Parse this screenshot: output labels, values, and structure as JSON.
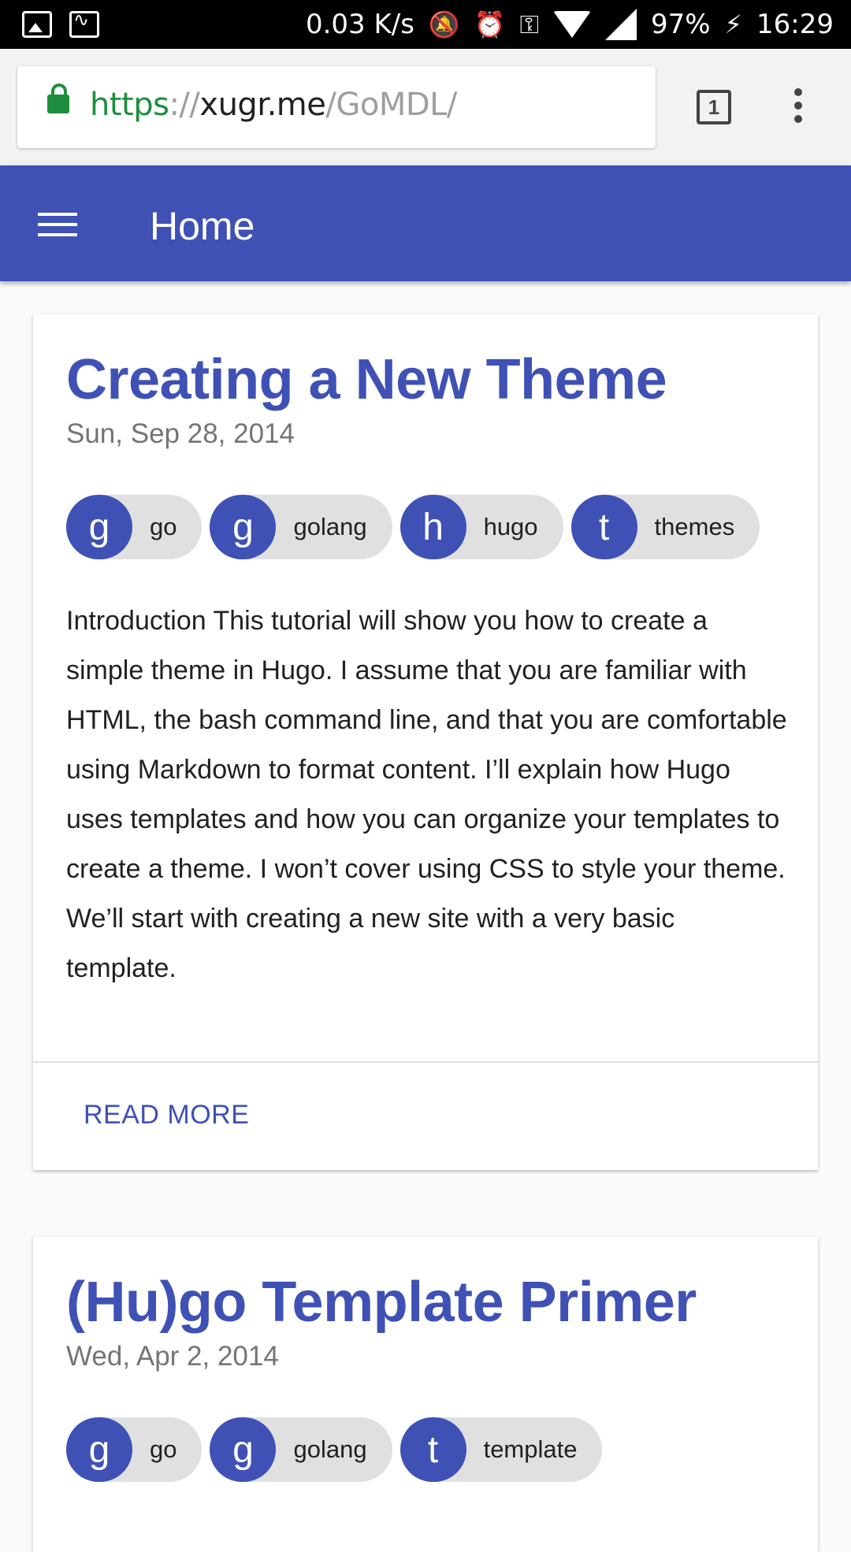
{
  "status_bar": {
    "speed": "0.03 K/s",
    "battery": "97%",
    "time": "16:29"
  },
  "browser": {
    "url_scheme": "https",
    "url_sep": "://",
    "url_host": "xugr.me",
    "url_path": "/GoMDL/",
    "tab_count": "1"
  },
  "app_bar": {
    "title": "Home"
  },
  "posts": [
    {
      "title": "Creating a New Theme",
      "date": "Sun, Sep 28, 2014",
      "tags": [
        {
          "initial": "g",
          "label": "go"
        },
        {
          "initial": "g",
          "label": "golang"
        },
        {
          "initial": "h",
          "label": "hugo"
        },
        {
          "initial": "t",
          "label": "themes"
        }
      ],
      "excerpt": "Introduction This tutorial will show you how to create a simple theme in Hugo. I assume that you are familiar with HTML, the bash command line, and that you are comfortable using Markdown to format content. I’ll explain how Hugo uses templates and how you can organize your templates to create a theme. I won’t cover using CSS to style your theme. We’ll start with creating a new site with a very basic template.",
      "read_more": "READ MORE"
    },
    {
      "title": "(Hu)go Template Primer",
      "date": "Wed, Apr 2, 2014",
      "tags": [
        {
          "initial": "g",
          "label": "go"
        },
        {
          "initial": "g",
          "label": "golang"
        },
        {
          "initial": "t",
          "label": "template"
        }
      ]
    }
  ]
}
